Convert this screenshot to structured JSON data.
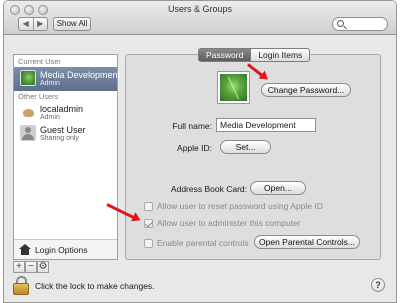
{
  "window": {
    "title": "Users & Groups"
  },
  "toolbar": {
    "back_glyph": "◀",
    "forward_glyph": "▶",
    "show_all_label": "Show All"
  },
  "sidebar": {
    "current_user_label": "Current User",
    "other_users_label": "Other Users",
    "users": [
      {
        "name": "Media Development",
        "role": "Admin",
        "icon": "green-leaf-avatar",
        "selected": true
      },
      {
        "name": "localadmin",
        "role": "Admin",
        "icon": "bird-avatar",
        "selected": false
      },
      {
        "name": "Guest User",
        "role": "Sharing only",
        "icon": "guest-silhouette-avatar",
        "selected": false
      }
    ],
    "login_options_label": "Login Options",
    "bottom_buttons": [
      "+",
      "−",
      "⚙"
    ]
  },
  "tabs": [
    {
      "label": "Password",
      "active": true
    },
    {
      "label": "Login Items",
      "active": false
    }
  ],
  "panel": {
    "change_password_label": "Change Password...",
    "full_name_label": "Full name:",
    "full_name_value": "Media Development",
    "apple_id_label": "Apple ID:",
    "apple_id_button": "Set...",
    "address_book_label": "Address Book Card:",
    "address_book_button": "Open...",
    "checkboxes": [
      {
        "label": "Allow user to reset password using Apple ID",
        "checked": false,
        "enabled": false
      },
      {
        "label": "Allow user to administer this computer",
        "checked": true,
        "enabled": false
      },
      {
        "label": "Enable parental controls",
        "checked": false,
        "enabled": false
      }
    ],
    "parental_controls_button": "Open Parental Controls..."
  },
  "footer": {
    "lock_text": "Click the lock to make changes.",
    "help_label": "?"
  },
  "colors": {
    "annotation_arrow": "#e0161b",
    "selection": "#6b7c98"
  }
}
